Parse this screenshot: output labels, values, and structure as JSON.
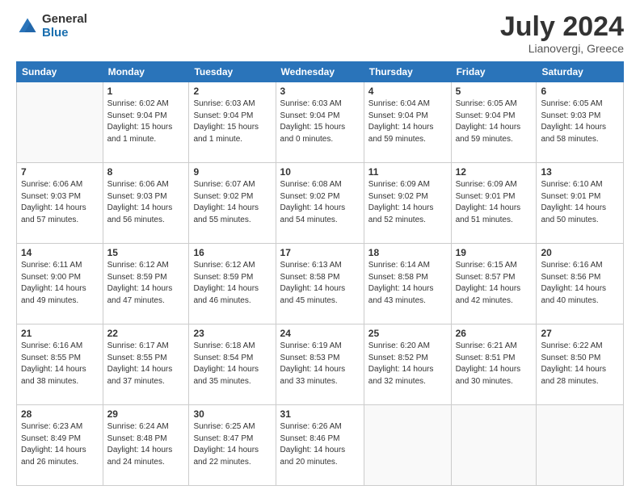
{
  "logo": {
    "general": "General",
    "blue": "Blue"
  },
  "title": "July 2024",
  "subtitle": "Lianovergi, Greece",
  "days_of_week": [
    "Sunday",
    "Monday",
    "Tuesday",
    "Wednesday",
    "Thursday",
    "Friday",
    "Saturday"
  ],
  "weeks": [
    [
      {
        "day": "",
        "info": ""
      },
      {
        "day": "1",
        "info": "Sunrise: 6:02 AM\nSunset: 9:04 PM\nDaylight: 15 hours\nand 1 minute."
      },
      {
        "day": "2",
        "info": "Sunrise: 6:03 AM\nSunset: 9:04 PM\nDaylight: 15 hours\nand 1 minute."
      },
      {
        "day": "3",
        "info": "Sunrise: 6:03 AM\nSunset: 9:04 PM\nDaylight: 15 hours\nand 0 minutes."
      },
      {
        "day": "4",
        "info": "Sunrise: 6:04 AM\nSunset: 9:04 PM\nDaylight: 14 hours\nand 59 minutes."
      },
      {
        "day": "5",
        "info": "Sunrise: 6:05 AM\nSunset: 9:04 PM\nDaylight: 14 hours\nand 59 minutes."
      },
      {
        "day": "6",
        "info": "Sunrise: 6:05 AM\nSunset: 9:03 PM\nDaylight: 14 hours\nand 58 minutes."
      }
    ],
    [
      {
        "day": "7",
        "info": "Sunrise: 6:06 AM\nSunset: 9:03 PM\nDaylight: 14 hours\nand 57 minutes."
      },
      {
        "day": "8",
        "info": "Sunrise: 6:06 AM\nSunset: 9:03 PM\nDaylight: 14 hours\nand 56 minutes."
      },
      {
        "day": "9",
        "info": "Sunrise: 6:07 AM\nSunset: 9:02 PM\nDaylight: 14 hours\nand 55 minutes."
      },
      {
        "day": "10",
        "info": "Sunrise: 6:08 AM\nSunset: 9:02 PM\nDaylight: 14 hours\nand 54 minutes."
      },
      {
        "day": "11",
        "info": "Sunrise: 6:09 AM\nSunset: 9:02 PM\nDaylight: 14 hours\nand 52 minutes."
      },
      {
        "day": "12",
        "info": "Sunrise: 6:09 AM\nSunset: 9:01 PM\nDaylight: 14 hours\nand 51 minutes."
      },
      {
        "day": "13",
        "info": "Sunrise: 6:10 AM\nSunset: 9:01 PM\nDaylight: 14 hours\nand 50 minutes."
      }
    ],
    [
      {
        "day": "14",
        "info": "Sunrise: 6:11 AM\nSunset: 9:00 PM\nDaylight: 14 hours\nand 49 minutes."
      },
      {
        "day": "15",
        "info": "Sunrise: 6:12 AM\nSunset: 8:59 PM\nDaylight: 14 hours\nand 47 minutes."
      },
      {
        "day": "16",
        "info": "Sunrise: 6:12 AM\nSunset: 8:59 PM\nDaylight: 14 hours\nand 46 minutes."
      },
      {
        "day": "17",
        "info": "Sunrise: 6:13 AM\nSunset: 8:58 PM\nDaylight: 14 hours\nand 45 minutes."
      },
      {
        "day": "18",
        "info": "Sunrise: 6:14 AM\nSunset: 8:58 PM\nDaylight: 14 hours\nand 43 minutes."
      },
      {
        "day": "19",
        "info": "Sunrise: 6:15 AM\nSunset: 8:57 PM\nDaylight: 14 hours\nand 42 minutes."
      },
      {
        "day": "20",
        "info": "Sunrise: 6:16 AM\nSunset: 8:56 PM\nDaylight: 14 hours\nand 40 minutes."
      }
    ],
    [
      {
        "day": "21",
        "info": "Sunrise: 6:16 AM\nSunset: 8:55 PM\nDaylight: 14 hours\nand 38 minutes."
      },
      {
        "day": "22",
        "info": "Sunrise: 6:17 AM\nSunset: 8:55 PM\nDaylight: 14 hours\nand 37 minutes."
      },
      {
        "day": "23",
        "info": "Sunrise: 6:18 AM\nSunset: 8:54 PM\nDaylight: 14 hours\nand 35 minutes."
      },
      {
        "day": "24",
        "info": "Sunrise: 6:19 AM\nSunset: 8:53 PM\nDaylight: 14 hours\nand 33 minutes."
      },
      {
        "day": "25",
        "info": "Sunrise: 6:20 AM\nSunset: 8:52 PM\nDaylight: 14 hours\nand 32 minutes."
      },
      {
        "day": "26",
        "info": "Sunrise: 6:21 AM\nSunset: 8:51 PM\nDaylight: 14 hours\nand 30 minutes."
      },
      {
        "day": "27",
        "info": "Sunrise: 6:22 AM\nSunset: 8:50 PM\nDaylight: 14 hours\nand 28 minutes."
      }
    ],
    [
      {
        "day": "28",
        "info": "Sunrise: 6:23 AM\nSunset: 8:49 PM\nDaylight: 14 hours\nand 26 minutes."
      },
      {
        "day": "29",
        "info": "Sunrise: 6:24 AM\nSunset: 8:48 PM\nDaylight: 14 hours\nand 24 minutes."
      },
      {
        "day": "30",
        "info": "Sunrise: 6:25 AM\nSunset: 8:47 PM\nDaylight: 14 hours\nand 22 minutes."
      },
      {
        "day": "31",
        "info": "Sunrise: 6:26 AM\nSunset: 8:46 PM\nDaylight: 14 hours\nand 20 minutes."
      },
      {
        "day": "",
        "info": ""
      },
      {
        "day": "",
        "info": ""
      },
      {
        "day": "",
        "info": ""
      }
    ]
  ]
}
